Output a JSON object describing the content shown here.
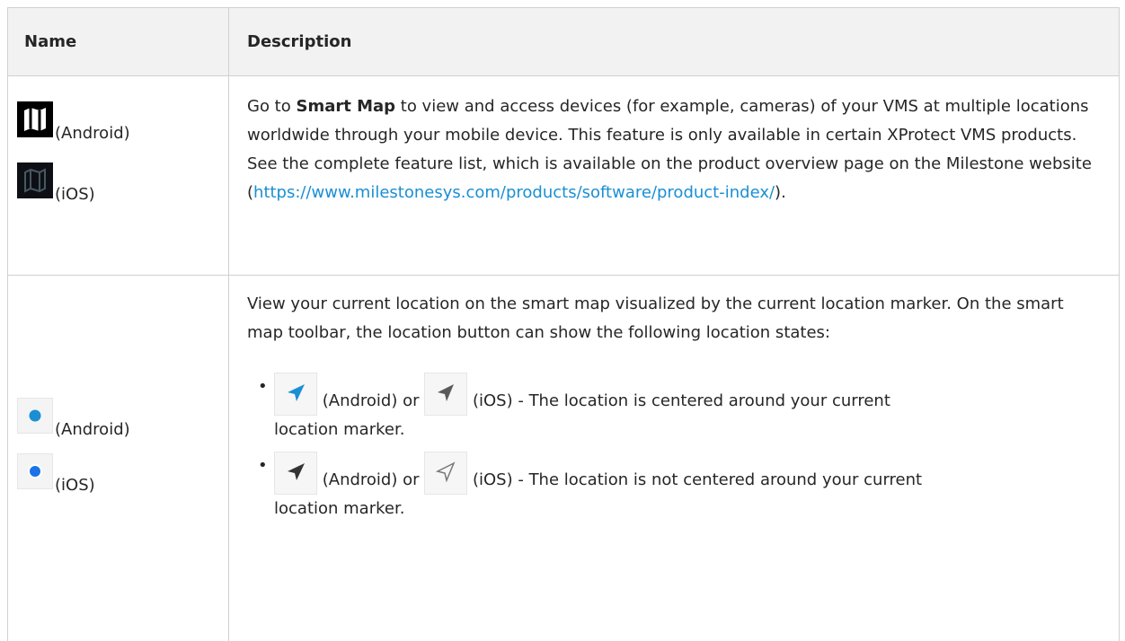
{
  "table": {
    "header": {
      "name": "Name",
      "description": "Description"
    },
    "rows": [
      {
        "name_items": [
          {
            "icon": "smart-map-android-icon",
            "label": "(Android)"
          },
          {
            "icon": "smart-map-ios-icon",
            "label": "(iOS)"
          }
        ],
        "desc": {
          "pre": "Go to ",
          "bold": "Smart Map",
          "post": " to view and access devices (for example, cameras) of your VMS at multiple locations worldwide through your mobile device. This feature is only available in certain XProtect VMS products. See the complete feature list, which is available on the product overview page on the Milestone website (",
          "link": "https://www.milestonesys.com/products/software/product-index/",
          "end": ")."
        }
      },
      {
        "name_items": [
          {
            "icon": "location-marker-android-icon",
            "label": "(Android)"
          },
          {
            "icon": "location-marker-ios-icon",
            "label": "(iOS)"
          }
        ],
        "desc": {
          "intro": "View your current location on the smart map visualized by the current location marker. On the smart map toolbar, the location button can show the following location states:",
          "states": [
            {
              "android_icon": "location-arrow-centered-android-icon",
              "ios_icon": "location-arrow-centered-ios-icon",
              "android_label": "(Android) or",
              "ios_label": "(iOS) - The location is centered around your current",
              "tail": "location marker."
            },
            {
              "android_icon": "location-arrow-not-centered-android-icon",
              "ios_icon": "location-arrow-not-centered-ios-icon",
              "android_label": "(Android) or",
              "ios_label": "(iOS) - The location is not centered around your current",
              "tail": "location marker."
            }
          ]
        }
      }
    ]
  },
  "colors": {
    "link": "#1a8fd4",
    "border": "#d0d0d0",
    "header_bg": "#f2f2f2",
    "android_blue": "#1a8fd4",
    "ios_blue": "#1a73e8"
  }
}
